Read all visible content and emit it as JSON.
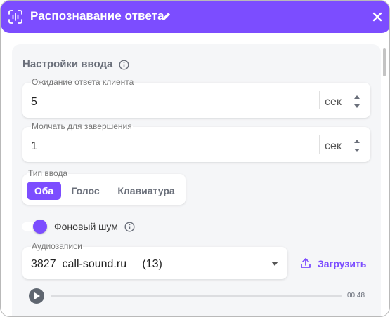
{
  "header": {
    "title": "Распознавание ответа",
    "icon": "voice-recognition-icon",
    "background": "#7c4dff"
  },
  "settings": {
    "title": "Настройки ввода"
  },
  "wait_field": {
    "label": "Ожидание ответа клиента",
    "value": "5",
    "unit": "сек"
  },
  "silence_field": {
    "label": "Молчать для завершения",
    "value": "1",
    "unit": "сек"
  },
  "input_type": {
    "label": "Тип ввода",
    "options": [
      "Оба",
      "Голос",
      "Клавиатура"
    ],
    "selected": "Оба"
  },
  "background_noise": {
    "label": "Фоновый шум",
    "enabled": true
  },
  "audio": {
    "label": "Аудиозаписи",
    "value": "3827_call-sound.ru__ (13)",
    "upload_label": "Загрузить",
    "progress": 0.0,
    "duration": "00:48"
  }
}
